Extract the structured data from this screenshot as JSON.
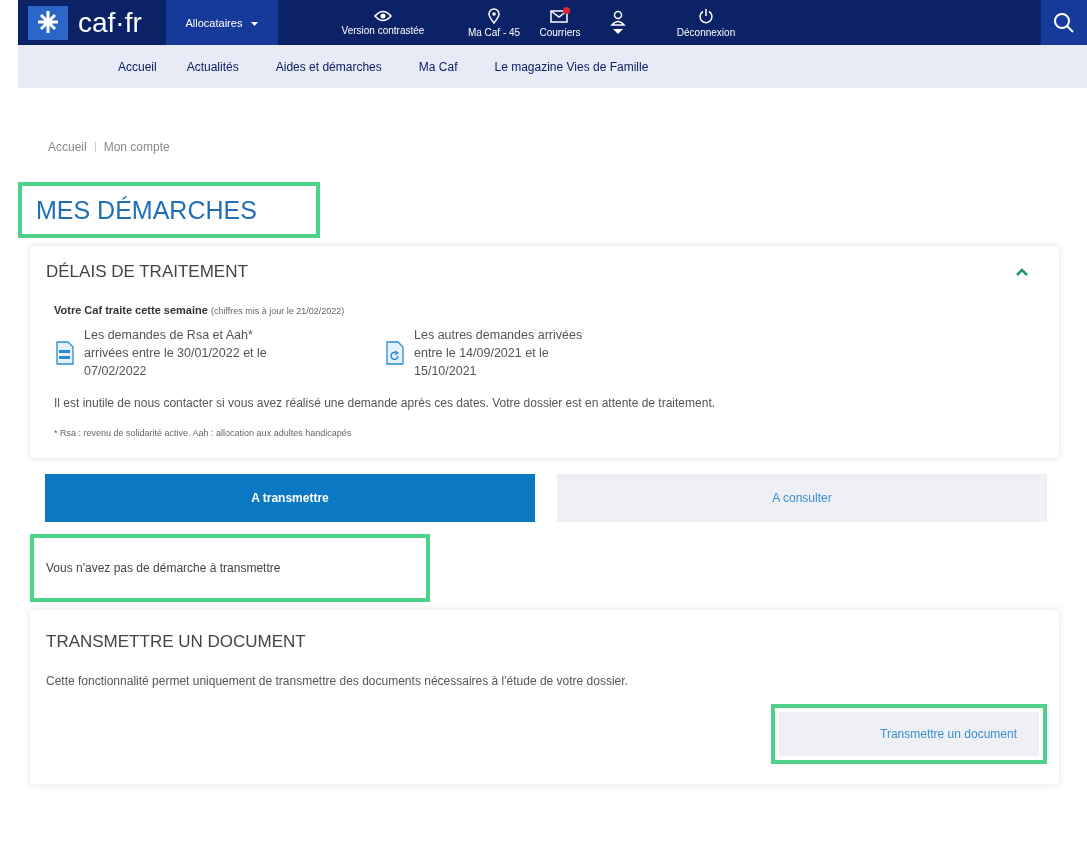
{
  "header": {
    "logo": "caf·fr",
    "audience": "Allocataires",
    "actions": [
      {
        "kind": "eye",
        "label": "Version contrastée"
      },
      {
        "kind": "pin",
        "label": "Ma Caf - 45"
      },
      {
        "kind": "mail",
        "label": "Courriers",
        "notification": true
      },
      {
        "kind": "user"
      },
      {
        "kind": "power",
        "label": "Déconnexion"
      }
    ]
  },
  "nav": [
    "Accueil",
    "Actualités",
    "Aides et démarches",
    "Ma Caf",
    "Le magazine Vies de Famille"
  ],
  "breadcrumb": [
    "Accueil",
    "Mon compte"
  ],
  "page_title": "MES DÉMARCHES",
  "delays": {
    "title": "DÉLAIS DE TRAITEMENT",
    "expanded": true,
    "intro_bold": "Votre Caf traite cette semaine",
    "intro_note": "(chiffres mis à jour le 21/02/2022)",
    "items": [
      {
        "kind": "rsa",
        "text": "Les demandes de Rsa et Aah* arrivées entre le 30/01/2022 et le 07/02/2022"
      },
      {
        "kind": "other",
        "text": "Les autres demandes arrivées entre le 14/09/2021 et le 15/10/2021"
      }
    ],
    "notice": "Il est inutile de nous contacter si vous avez réalisé une demande après ces dates. Votre dossier est en attente de traitement.",
    "footnote": "* Rsa : revenu de solidarité active. Aah : allocation aux adultes handicapés"
  },
  "tabs": [
    {
      "label": "A transmettre",
      "selected": true
    },
    {
      "label": "A consulter",
      "selected": false
    }
  ],
  "empty_message": "Vous n'avez pas de démarche à transmettre",
  "transmit": {
    "title": "TRANSMETTRE UN DOCUMENT",
    "text": "Cette fonctionnalité permet uniquement de transmettre des documents nécessaires à l'étude de votre dossier.",
    "button": "Transmettre un document"
  }
}
